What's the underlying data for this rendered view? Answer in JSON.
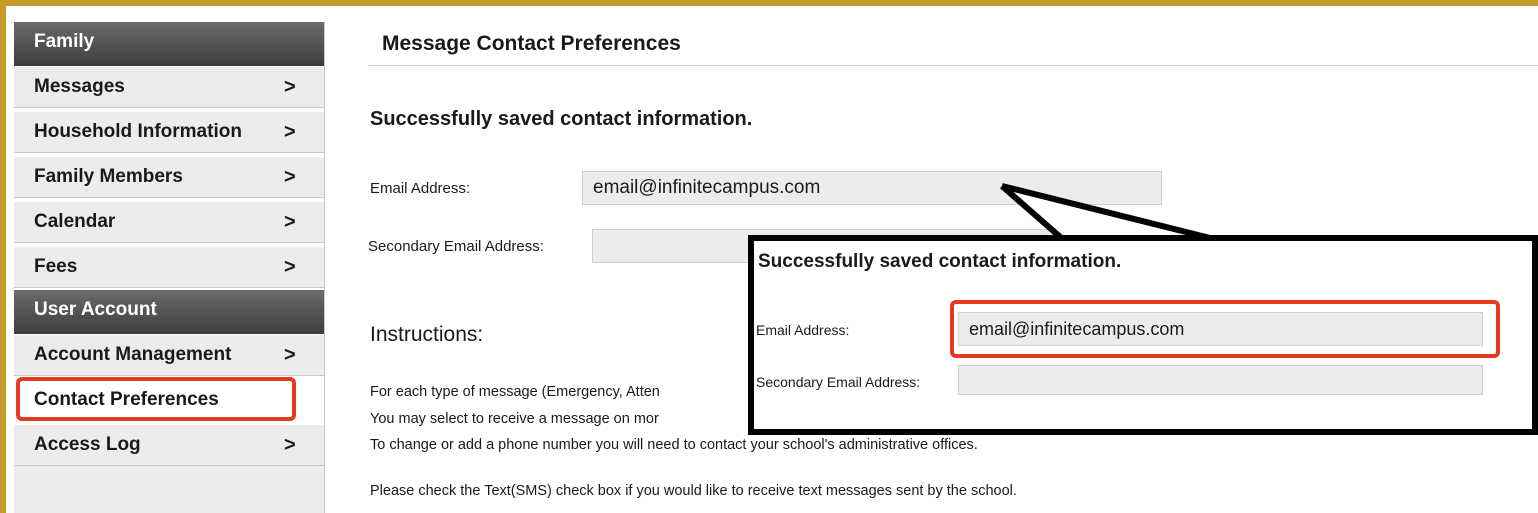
{
  "sidebar": {
    "family_header": "Family",
    "family_items": [
      {
        "label": "Messages",
        "chevron": ">"
      },
      {
        "label": "Household Information",
        "chevron": ">"
      },
      {
        "label": "Family Members",
        "chevron": ">"
      },
      {
        "label": "Calendar",
        "chevron": ">"
      },
      {
        "label": "Fees",
        "chevron": ">"
      }
    ],
    "account_header": "User Account",
    "account_items": [
      {
        "label": "Account Management",
        "chevron": ">"
      },
      {
        "label": "Contact Preferences",
        "chevron": ""
      },
      {
        "label": "Access Log",
        "chevron": ">"
      }
    ],
    "active_item": "Contact Preferences"
  },
  "main": {
    "title": "Message Contact Preferences",
    "success_message": "Successfully saved contact information.",
    "email_label": "Email Address:",
    "email_value": "email@infinitecampus.com",
    "secondary_email_label": "Secondary Email Address:",
    "secondary_email_value": "",
    "instructions_title": "Instructions:",
    "instructions": [
      "For each type of message (Emergency, Atten",
      "You may select to receive a message on mor",
      "To change or add a phone number you will need to contact your school's administrative offices.",
      "Please check the Text(SMS) check box if you would like to receive text messages sent by the school."
    ]
  },
  "zoom_callout": {
    "success_message": "Successfully saved contact information.",
    "email_label": "Email Address:",
    "email_value": "email@infinitecampus.com",
    "secondary_email_label": "Secondary Email Address:",
    "secondary_email_value": ""
  },
  "colors": {
    "highlight": "#e43a1e",
    "sidebar_header": "#4a4a4a",
    "frame": "#c79a2d"
  }
}
